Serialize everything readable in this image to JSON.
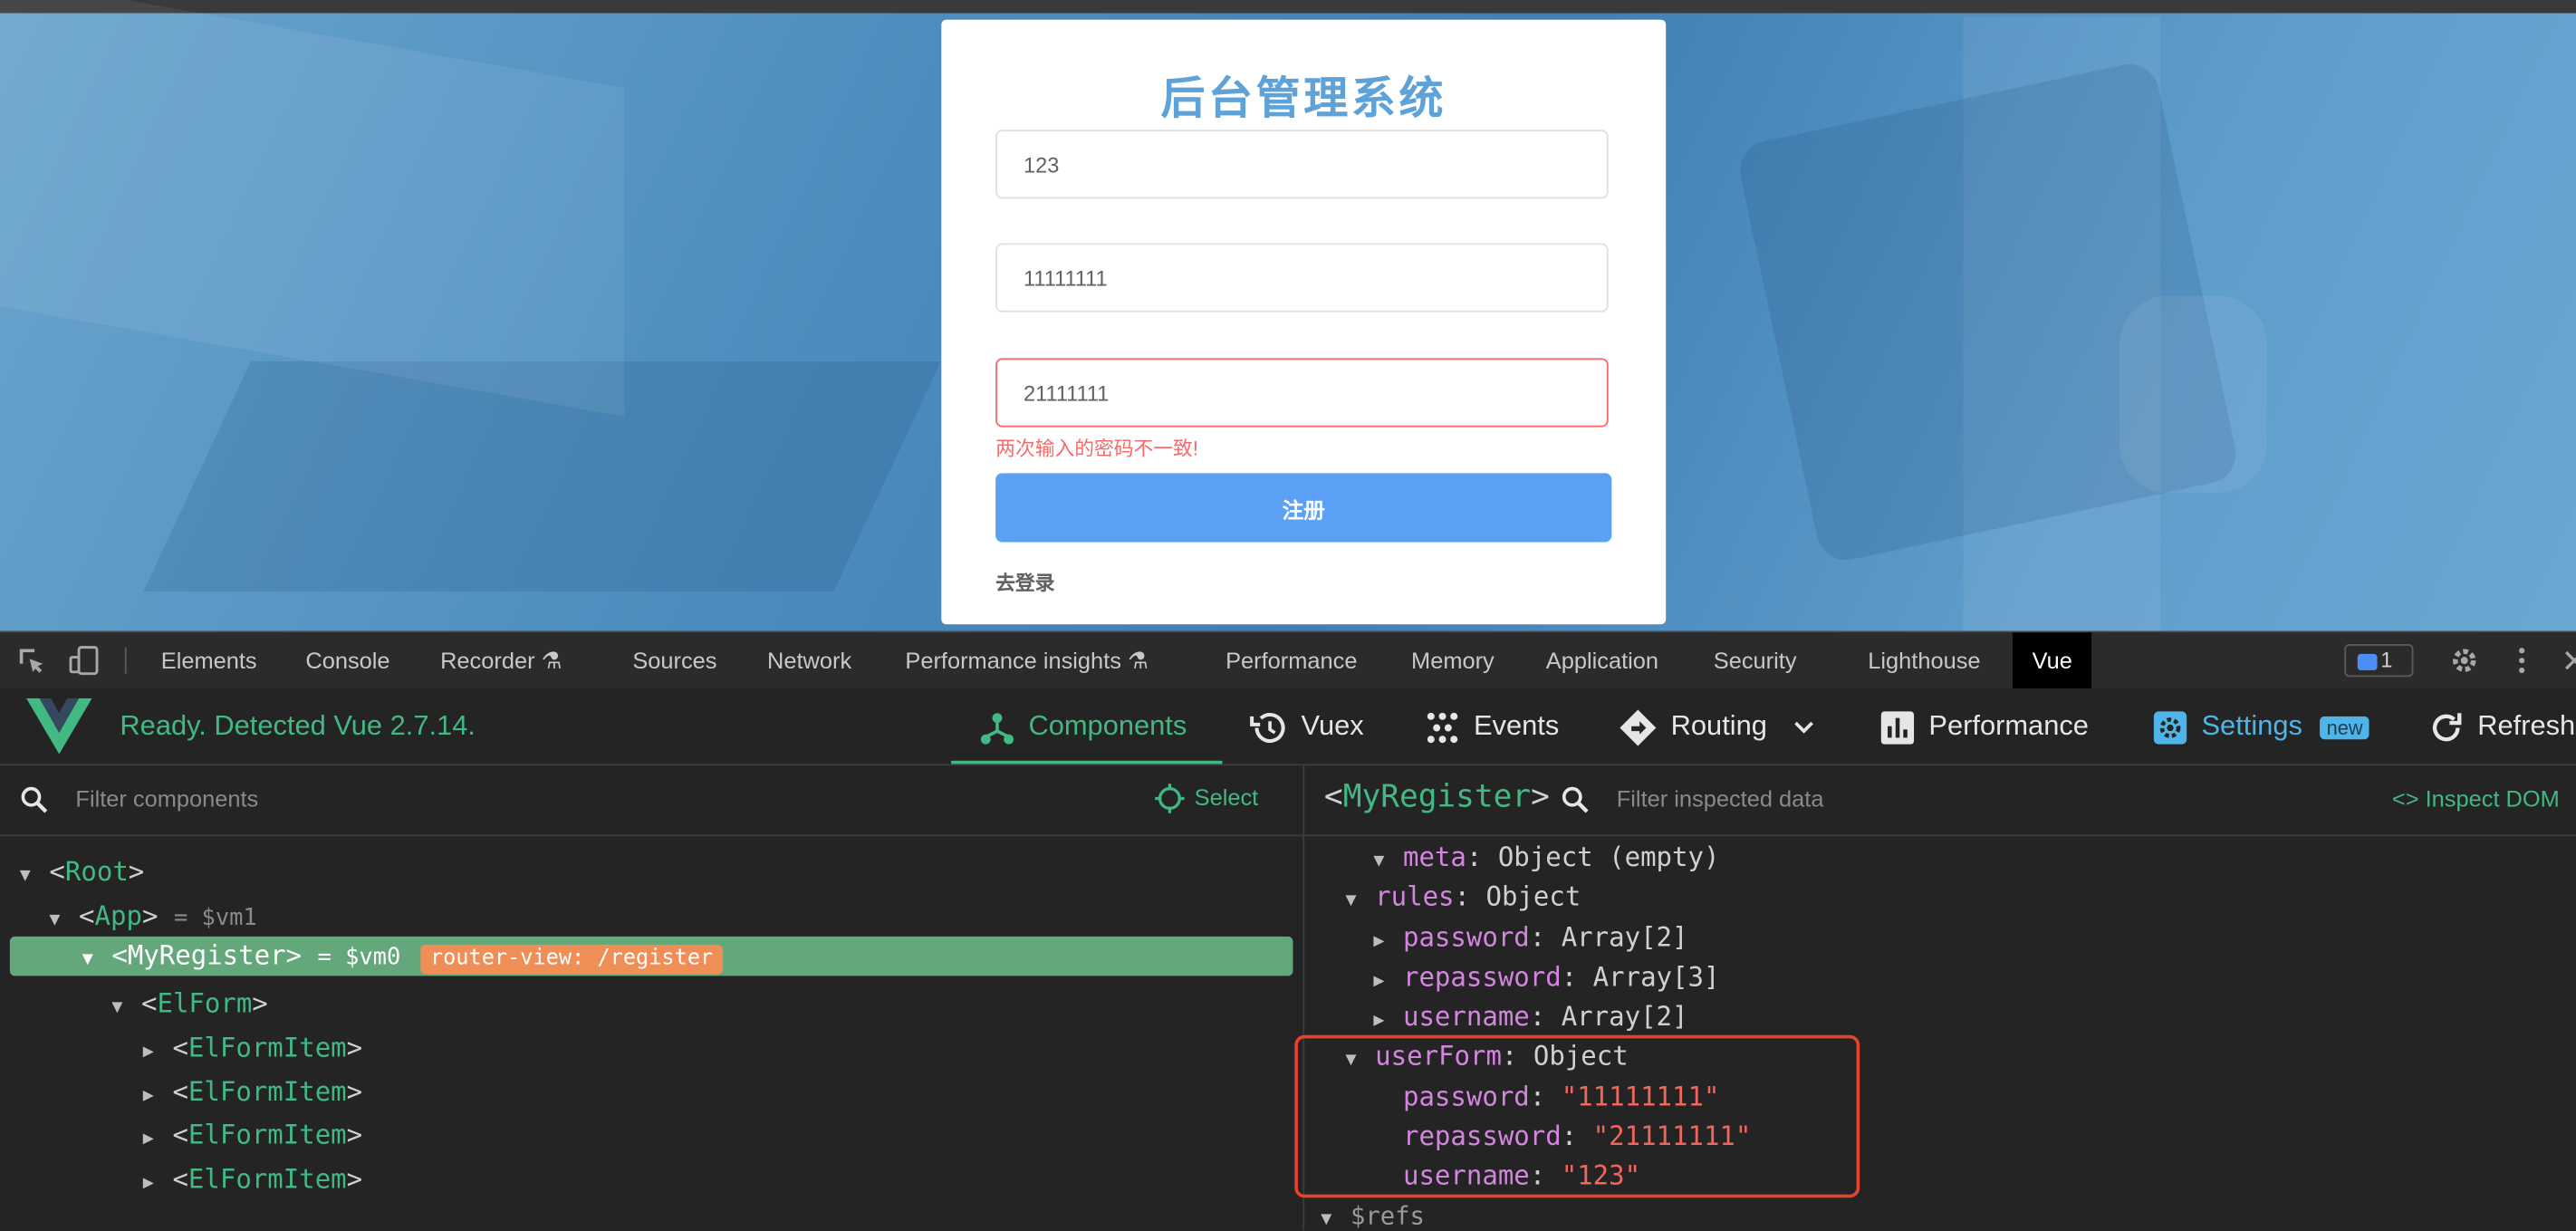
{
  "login": {
    "title": "后台管理系统",
    "username_value": "123",
    "password_value": "11111111",
    "repassword_value": "21111111",
    "error_message": "两次输入的密码不一致!",
    "register_label": "注册",
    "goto_login_label": "去登录"
  },
  "devtools": {
    "tabs": [
      "Elements",
      "Console",
      "Recorder",
      "Sources",
      "Network",
      "Performance insights",
      "Performance",
      "Memory",
      "Application",
      "Security",
      "Lighthouse",
      "Vue"
    ],
    "active_tab": "Vue",
    "message_count": "1"
  },
  "vue": {
    "status": "Ready. Detected Vue 2.7.14.",
    "tabs": {
      "components": "Components",
      "vuex": "Vuex",
      "events": "Events",
      "routing": "Routing",
      "performance": "Performance",
      "settings": "Settings",
      "settings_badge": "new",
      "refresh": "Refresh"
    },
    "filter_components_placeholder": "Filter components",
    "select_label": "Select",
    "selected_component": "MyRegister",
    "filter_data_placeholder": "Filter inspected data",
    "inspect_dom_label": "Inspect DOM",
    "tree": {
      "root": "Root",
      "app": "App",
      "app_vm": "= $vm1",
      "myregister": "MyRegister",
      "myregister_vm": "= $vm0",
      "router_badge": "router-view: /register",
      "elform": "ElForm",
      "elformitem": "ElFormItem"
    },
    "data": {
      "meta_key": "meta",
      "meta_val": "Object (empty)",
      "rules_key": "rules",
      "rules_val": "Object",
      "rules_password_key": "password",
      "rules_password_val": "Array[2]",
      "rules_repassword_key": "repassword",
      "rules_repassword_val": "Array[3]",
      "rules_username_key": "username",
      "rules_username_val": "Array[2]",
      "userform_key": "userForm",
      "userform_val": "Object",
      "uf_password_key": "password",
      "uf_password_val": "\"11111111\"",
      "uf_repassword_key": "repassword",
      "uf_repassword_val": "\"21111111\"",
      "uf_username_key": "username",
      "uf_username_val": "\"123\"",
      "refs_key": "$refs"
    }
  }
}
